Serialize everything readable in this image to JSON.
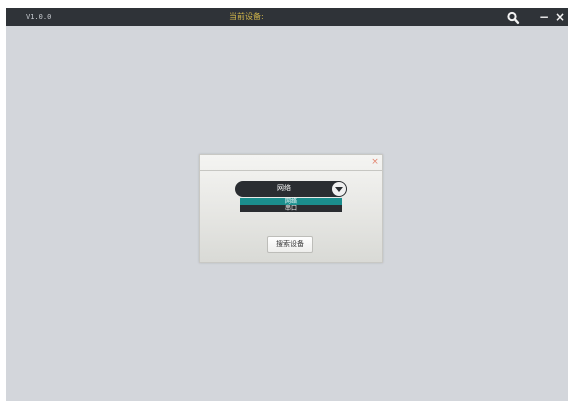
{
  "titlebar": {
    "version": "V1.0.0",
    "current_device": "当前设备:",
    "minimize_label": "−",
    "close_label": "×"
  },
  "dialog": {
    "close_label": "×",
    "connection_select": {
      "value": "网络",
      "options": [
        "网络",
        "串口"
      ]
    },
    "search_button_label": "搜索设备"
  },
  "icons": {
    "search": "search-icon",
    "dropdown": "chevron-down-icon"
  },
  "colors": {
    "titlebar_bg": "#2f3338",
    "window_bg": "#d3d6db",
    "device_text": "#d1b64a",
    "selected_option": "#1b8e8d",
    "dialog_close": "#e3856f"
  }
}
